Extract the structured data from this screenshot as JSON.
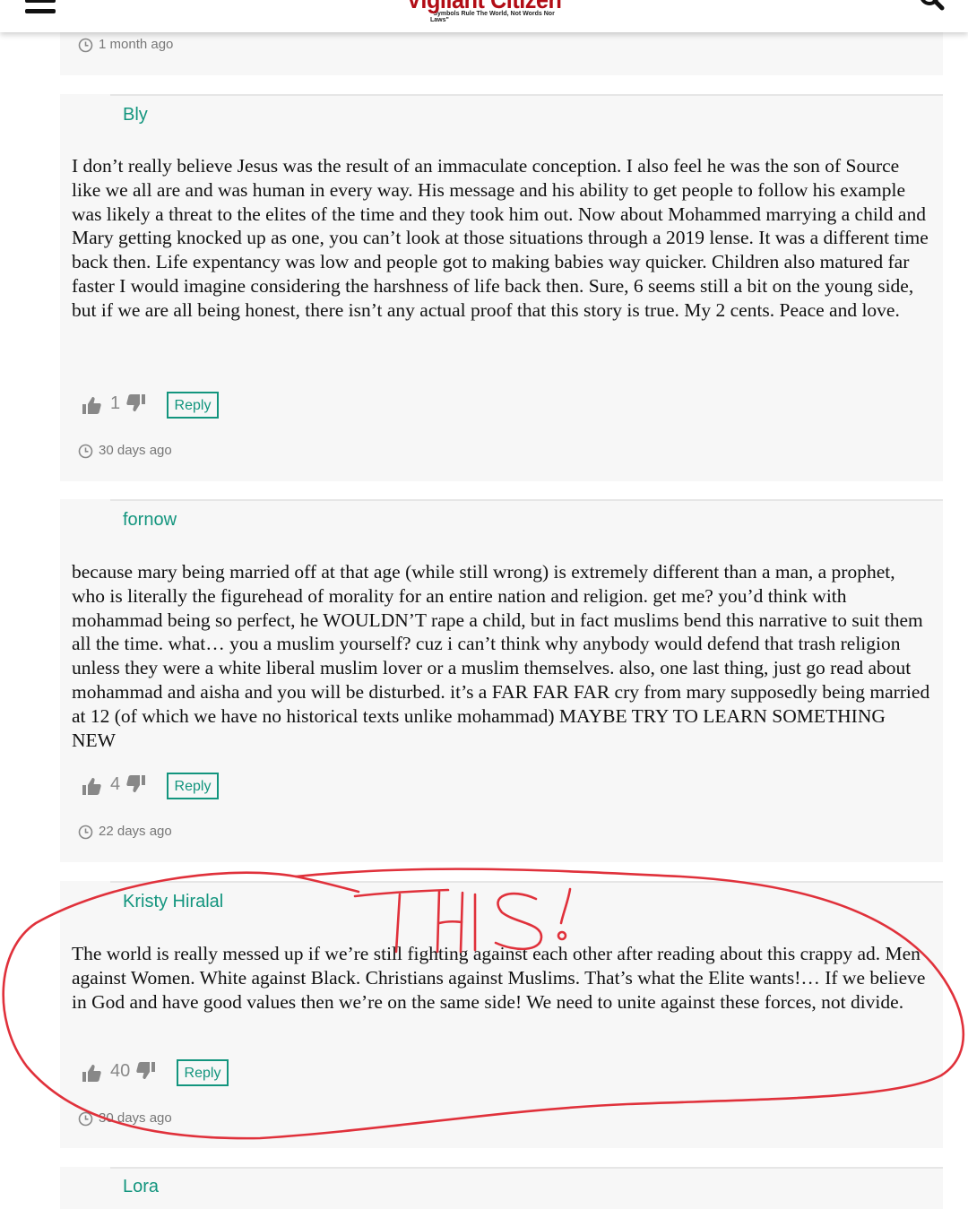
{
  "header": {
    "logo_text": "Vigilant Citizen",
    "logo_tagline": "\"Symbols Rule The World, Not Words Nor Laws\"",
    "menu_icon": "hamburger-menu-icon",
    "search_icon": "search-icon"
  },
  "colors": {
    "accent": "#13957e",
    "logo_red": "#b10d16",
    "annotation_red": "#e0313b",
    "card_bg": "#f7f7f7"
  },
  "comments": [
    {
      "time": "1 month ago"
    },
    {
      "author": "Bly",
      "text": "I don’t really believe Jesus was the result of an immaculate conception. I also feel he was the son of Source like we all are and was human in every way. His message and his ability to get people to follow his example was likely a threat to the elites of the time and they took him out. Now about Mohammed marrying a child and Mary getting knocked up as one, you can’t look at those situations through a 2019 lense. It was a different time back then. Life expentancy was low and people got to making babies way quicker. Children also matured far faster I would imagine considering the harshness of life back then. Sure, 6 seems still a bit on the young side, but if we are all being honest, there isn’t any actual proof that this story is true. My 2 cents. Peace and love.",
      "votes": "1",
      "reply_label": "Reply",
      "time": "30 days ago"
    },
    {
      "author": "fornow",
      "text": "because mary being married off at that age (while still wrong) is extremely different than a man, a prophet, who is literally the figurehead of morality for an entire nation and religion. get me? you’d think with mohammad being so perfect, he WOULDN’T rape a child, but in fact muslims bend this narrative to suit them all the time. what… you a muslim yourself? cuz i can’t think why anybody would defend that trash religion unless they were a white liberal muslim lover or a muslim themselves. also, one last thing, just go read about mohammad and aisha and you will be disturbed. it’s a FAR FAR FAR cry from mary supposedly being married at 12 (of which we have no historical texts unlike mohammad) MAYBE TRY TO LEARN SOMETHING NEW",
      "votes": "4",
      "reply_label": "Reply",
      "time": "22 days ago"
    },
    {
      "author": "Kristy Hiralal",
      "text": "The world is really messed up if we’re still fighting against each other after reading about this crappy ad. Men against Women. White against Black. Christians against Muslims. That’s what the Elite wants!… If we believe in God and have good values then we’re on the same side! We need to unite against these forces, not divide.",
      "votes": "40",
      "reply_label": "Reply",
      "time": "30 days ago"
    },
    {
      "author": "Lora"
    }
  ],
  "annotation": {
    "text": "THIS!"
  }
}
